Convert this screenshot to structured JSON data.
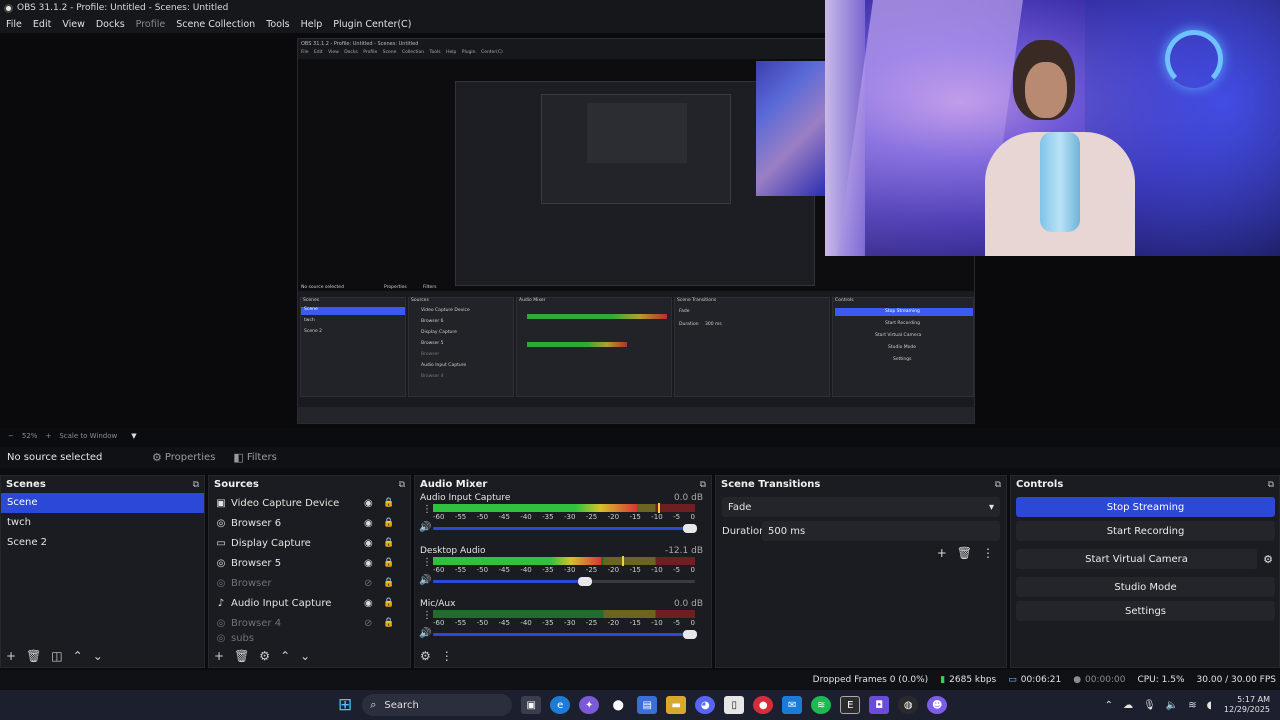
{
  "window": {
    "title": "OBS 31.1.2 - Profile: Untitled - Scenes: Untitled"
  },
  "menu": {
    "items": [
      "File",
      "Edit",
      "View",
      "Docks",
      "Profile",
      "Scene Collection",
      "Tools",
      "Help",
      "Plugin Center(C)"
    ]
  },
  "preview": {
    "zoom": "52%",
    "scale_mode": "Scale to Window"
  },
  "nested": {
    "title": "OBS 31.1.2 - Profile: Untitled - Scenes: Untitled",
    "menu": "File Edit View Docks Profile Scene Collection Tools Help Plugin Center(C)",
    "no_source": "No source selected",
    "properties": "Properties",
    "filters": "Filters",
    "scenes_label": "Scenes",
    "scenes": [
      "Scene",
      "twch",
      "Scene 2"
    ],
    "sources_label": "Sources",
    "sources": [
      "Video Capture Device",
      "Browser 6",
      "Display Capture",
      "Browser 5",
      "Browser",
      "Audio Input Capture",
      "Browser 4"
    ],
    "mixer_label": "Audio Mixer",
    "transitions_label": "Scene Transitions",
    "fade": "Fade",
    "duration": "Duration",
    "duration_value": "300 ms",
    "controls_label": "Controls",
    "controls": [
      "Stop Streaming",
      "Start Recording",
      "Start Virtual Camera",
      "Studio Mode",
      "Settings"
    ]
  },
  "propbar": {
    "no_source": "No source selected",
    "properties": "Properties",
    "filters": "Filters"
  },
  "scenes": {
    "title": "Scenes",
    "items": [
      "Scene",
      "twch",
      "Scene 2"
    ],
    "selected": 0
  },
  "sources": {
    "title": "Sources",
    "items": [
      {
        "name": "Video Capture Device",
        "icon": "camera-icon",
        "visible": true
      },
      {
        "name": "Browser 6",
        "icon": "globe-icon",
        "visible": true
      },
      {
        "name": "Display Capture",
        "icon": "monitor-icon",
        "visible": true
      },
      {
        "name": "Browser 5",
        "icon": "globe-icon",
        "visible": true
      },
      {
        "name": "Browser",
        "icon": "globe-icon",
        "visible": false
      },
      {
        "name": "Audio Input Capture",
        "icon": "mic-icon",
        "visible": true
      },
      {
        "name": "Browser 4",
        "icon": "globe-icon",
        "visible": false
      },
      {
        "name": "subs",
        "icon": "globe-icon",
        "visible": false
      }
    ]
  },
  "mixer": {
    "title": "Audio Mixer",
    "channels": [
      {
        "name": "Audio Input Capture",
        "db": "0.0 dB",
        "level": 0.78,
        "volume": 1.0
      },
      {
        "name": "Desktop Audio",
        "db": "-12.1 dB",
        "level": 0.64,
        "volume": 0.6
      },
      {
        "name": "Mic/Aux",
        "db": "0.0 dB",
        "level": 0.0,
        "volume": 1.0
      }
    ],
    "ticks": [
      "-60",
      "-55",
      "-50",
      "-45",
      "-40",
      "-35",
      "-30",
      "-25",
      "-20",
      "-15",
      "-10",
      "-5",
      "0"
    ]
  },
  "transitions": {
    "title": "Scene Transitions",
    "selected": "Fade",
    "duration_label": "Duration",
    "duration_value": "500 ms"
  },
  "controls": {
    "title": "Controls",
    "buttons": [
      "Stop Streaming",
      "Start Recording",
      "Start Virtual Camera",
      "Studio Mode",
      "Settings"
    ]
  },
  "status": {
    "dropped": "Dropped Frames 0 (0.0%)",
    "bitrate": "2685 kbps",
    "stream_time": "00:06:21",
    "rec_time": "00:00:00",
    "cpu": "CPU: 1.5%",
    "fps": "30.00 / 30.00 FPS"
  },
  "taskbar": {
    "search": "Search",
    "time": "5:17 AM",
    "date": "12/29/2025",
    "accent": "#4cc2ff"
  }
}
